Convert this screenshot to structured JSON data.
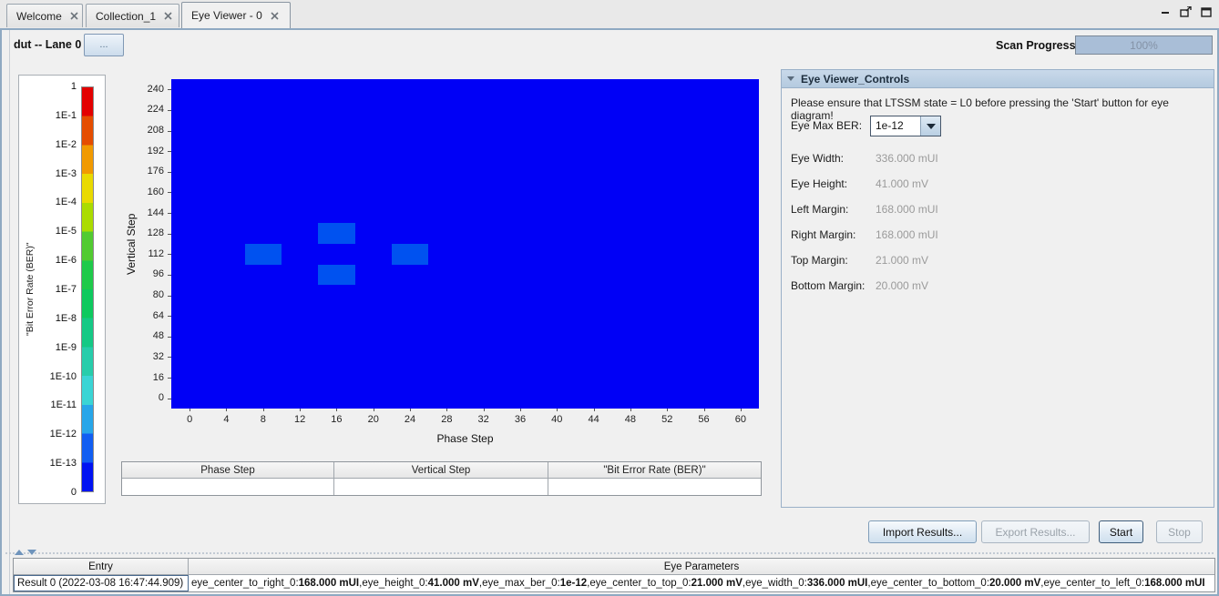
{
  "window": {
    "tabs": [
      {
        "label": "Welcome"
      },
      {
        "label": "Collection_1"
      },
      {
        "label": "Eye Viewer - 0",
        "active": true
      }
    ],
    "window_icons": [
      "minimize-icon",
      "float-window-icon",
      "maximize-icon"
    ]
  },
  "toolbar": {
    "device_label": "dut -- Lane 0",
    "browse_button": "...",
    "scan_progress_label": "Scan Progress",
    "scan_progress_value": "100%"
  },
  "colorbar": {
    "title": "\"Bit Error Rate (BER)\"",
    "tick_labels": [
      "1",
      "1E-1",
      "1E-2",
      "1E-3",
      "1E-4",
      "1E-5",
      "1E-6",
      "1E-7",
      "1E-8",
      "1E-9",
      "1E-10",
      "1E-11",
      "1E-12",
      "1E-13",
      "0"
    ],
    "segment_colors": [
      "#e30000",
      "#e54d00",
      "#f19a00",
      "#e9da00",
      "#abdc00",
      "#52cb31",
      "#1fca4a",
      "#0ec95e",
      "#15c985",
      "#27cdab",
      "#3ad5d5",
      "#27a6e9",
      "#115ef2",
      "#0013f2"
    ]
  },
  "chart_data": {
    "type": "heatmap",
    "xlabel": "Phase Step",
    "ylabel": "Vertical Step",
    "x_ticks": [
      0,
      4,
      8,
      12,
      16,
      20,
      24,
      28,
      32,
      36,
      40,
      44,
      48,
      52,
      56,
      60
    ],
    "y_ticks": [
      0,
      16,
      32,
      48,
      64,
      80,
      96,
      112,
      128,
      144,
      160,
      176,
      192,
      208,
      224,
      240
    ],
    "x_range": [
      -2,
      62
    ],
    "y_range": [
      -8,
      248
    ],
    "legend": "colorbar maps BER 1 (red) down to 0 (deep blue), log decades 1E-1..1E-13",
    "background": {
      "color": "#0000f6",
      "ber_estimate": "~0"
    },
    "cells": [
      {
        "phase": 8,
        "vertical": 112,
        "phase_span": 4,
        "vertical_span": 16,
        "color": "#0052f0",
        "ber_estimate": "~1e-12"
      },
      {
        "phase": 16,
        "vertical": 128,
        "phase_span": 4,
        "vertical_span": 16,
        "color": "#0052f0",
        "ber_estimate": "~1e-12"
      },
      {
        "phase": 16,
        "vertical": 96,
        "phase_span": 4,
        "vertical_span": 16,
        "color": "#0052f0",
        "ber_estimate": "~1e-12"
      },
      {
        "phase": 24,
        "vertical": 112,
        "phase_span": 4,
        "vertical_span": 16,
        "color": "#0052f0",
        "ber_estimate": "~1e-12"
      }
    ]
  },
  "hover_table": {
    "headers": [
      "Phase Step",
      "Vertical Step",
      "\"Bit Error Rate (BER)\""
    ],
    "row": [
      "",
      "",
      ""
    ]
  },
  "controls_panel": {
    "title": "Eye Viewer_Controls",
    "message": "Please ensure that LTSSM state = L0 before pressing the 'Start' button for eye diagram!",
    "eye_max_ber": {
      "label": "Eye Max BER:",
      "value": "1e-12"
    },
    "fields": [
      {
        "label": "Eye Width:",
        "value": "336.000 mUI"
      },
      {
        "label": "Eye Height:",
        "value": "41.000 mV"
      },
      {
        "label": "Left Margin:",
        "value": "168.000 mUI"
      },
      {
        "label": "Right Margin:",
        "value": "168.000 mUI"
      },
      {
        "label": "Top Margin:",
        "value": "21.000 mV"
      },
      {
        "label": "Bottom Margin:",
        "value": "20.000 mV"
      }
    ]
  },
  "actions": {
    "import": {
      "label": "Import Results...",
      "enabled": true
    },
    "export": {
      "label": "Export Results...",
      "enabled": false
    },
    "start": {
      "label": "Start",
      "enabled": true
    },
    "stop": {
      "label": "Stop",
      "enabled": false
    }
  },
  "results": {
    "headers": [
      "Entry",
      "Eye Parameters"
    ],
    "rows": [
      {
        "entry": "Result 0 (2022-03-08 16:47:44.909)",
        "parameters": [
          {
            "key": "eye_center_to_right_0:",
            "value": "168.000 mUI"
          },
          {
            "key": "eye_height_0:",
            "value": "41.000 mV"
          },
          {
            "key": "eye_max_ber_0:",
            "value": "1e-12"
          },
          {
            "key": "eye_center_to_top_0:",
            "value": "21.000 mV"
          },
          {
            "key": "eye_width_0:",
            "value": "336.000 mUI"
          },
          {
            "key": "eye_center_to_bottom_0:",
            "value": "20.000 mV"
          },
          {
            "key": "eye_center_to_left_0:",
            "value": "168.000 mUI"
          }
        ]
      }
    ]
  }
}
